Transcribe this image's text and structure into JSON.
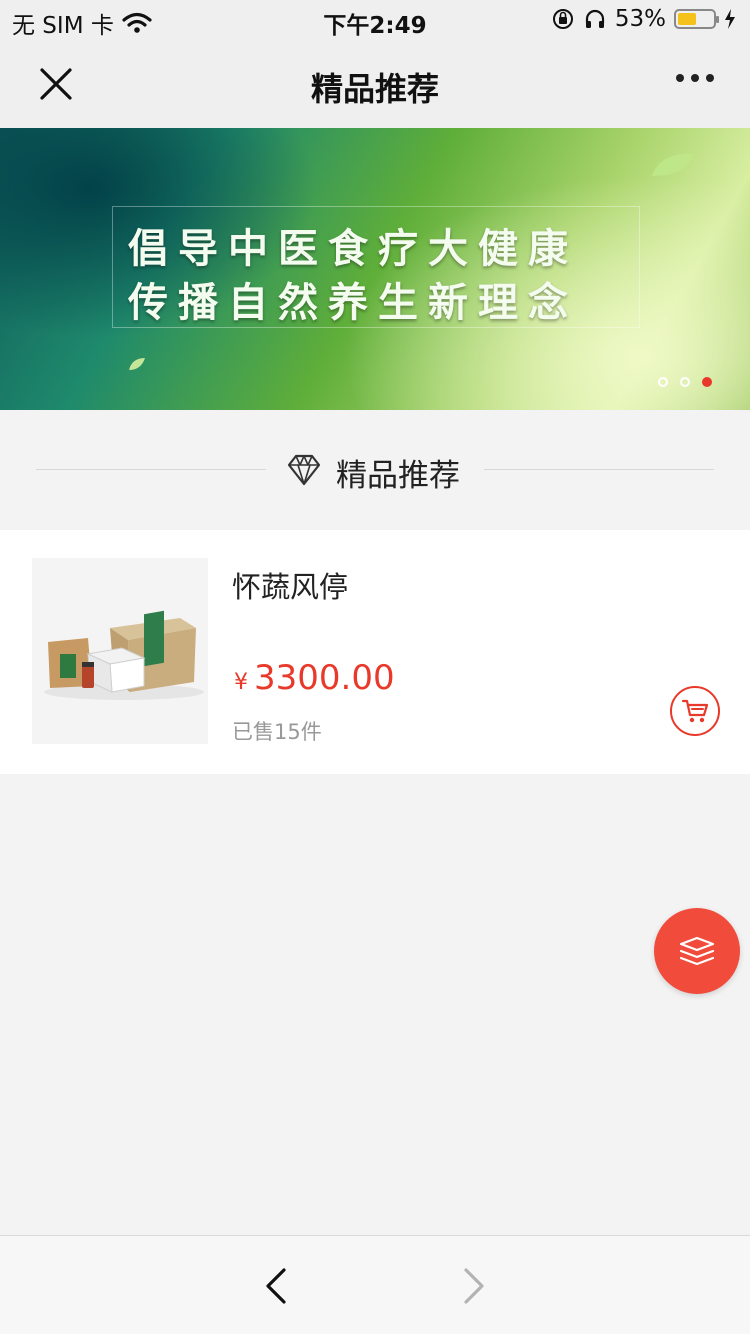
{
  "status_bar": {
    "carrier": "无 SIM 卡",
    "time": "下午2:49",
    "battery_percent": "53%",
    "battery_level": 0.53,
    "icons": [
      "wifi-icon",
      "orientation-lock-icon",
      "headphones-icon",
      "battery-icon",
      "charging-icon"
    ]
  },
  "nav": {
    "title": "精品推荐",
    "close_icon": "close-icon",
    "more_icon": "more-icon"
  },
  "banner": {
    "line1": "倡导中医食疗大健康",
    "line2": "传播自然养生新理念",
    "slide_count": 3,
    "active_slide": 3,
    "active_color": "#e8392a"
  },
  "section": {
    "title": "精品推荐",
    "icon": "diamond-icon"
  },
  "products": [
    {
      "name": "怀蔬风停",
      "currency": "¥",
      "price": "3300.00",
      "sold": "已售15件",
      "cart_icon": "cart-icon"
    }
  ],
  "fab": {
    "icon": "layers-icon",
    "color": "#f04b3b"
  },
  "toolbar": {
    "back_icon": "chevron-left-icon",
    "forward_icon": "chevron-right-icon"
  },
  "colors": {
    "accent": "#e8392a",
    "background": "#f3f3f3"
  }
}
